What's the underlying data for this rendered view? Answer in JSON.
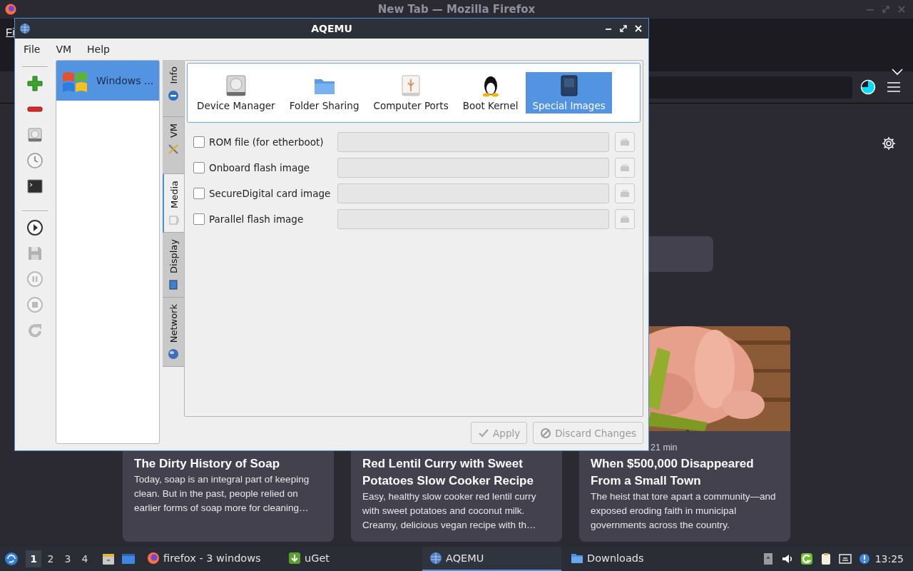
{
  "firefox": {
    "title": "New Tab — Mozilla Firefox",
    "menu": [
      "Fi"
    ],
    "cards": [
      {
        "title": "The Dirty History of Soap",
        "description": "Today, soap is an integral part of keeping clean. But in the past, people relied on earlier forms of soap more for cleaning…"
      },
      {
        "title": "Red Lentil Curry with Sweet Potatoes Slow Cooker Recipe",
        "description": "Easy, healthy slow cooker red lentil curry with sweet potatoes and coconut milk. Creamy, delicious vegan recipe with th…"
      },
      {
        "meta": "21 min",
        "title": "When $500,000 Disappeared From a Small Town",
        "description": "The heist that tore apart a community—and exposed eroding faith in municipal governments across the country."
      }
    ]
  },
  "aqemu": {
    "title": "AQEMU",
    "menu": [
      "File",
      "VM",
      "Help"
    ],
    "toolbar": [
      {
        "disabled": false
      },
      {
        "disabled": false
      },
      {
        "disabled": false
      },
      {
        "disabled": false
      },
      {
        "disabled": false
      },
      {
        "disabled": false
      },
      {
        "disabled": true
      },
      {
        "disabled": true
      },
      {
        "disabled": true
      },
      {
        "disabled": true
      }
    ],
    "vm_list": [
      {
        "name": "Windows ...",
        "selected": true
      }
    ],
    "side_tabs": [
      {
        "label": "Info",
        "selected": false
      },
      {
        "label": "VM",
        "selected": false
      },
      {
        "label": "Media",
        "selected": true
      },
      {
        "label": "Display",
        "selected": false
      },
      {
        "label": "Network",
        "selected": false
      }
    ],
    "sections": [
      {
        "label": "Device Manager",
        "selected": false
      },
      {
        "label": "Folder Sharing",
        "selected": false
      },
      {
        "label": "Computer Ports",
        "selected": false
      },
      {
        "label": "Boot Kernel",
        "selected": false
      },
      {
        "label": "Special Images",
        "selected": true
      }
    ],
    "images": [
      {
        "label": "ROM file (for etherboot)",
        "checked": false
      },
      {
        "label": "Onboard flash image",
        "checked": false
      },
      {
        "label": "SecureDigital card image",
        "checked": false
      },
      {
        "label": "Parallel flash image",
        "checked": false
      }
    ],
    "buttons": [
      {
        "label": "Apply",
        "disabled": true
      },
      {
        "label": "Discard Changes",
        "disabled": true
      }
    ]
  },
  "taskbar": {
    "workspaces": [
      {
        "label": "1",
        "selected": true
      },
      {
        "label": "2",
        "selected": false
      },
      {
        "label": "3",
        "selected": false
      },
      {
        "label": "4",
        "selected": false
      }
    ],
    "tasks": [
      {
        "label": "firefox - 3 windows",
        "selected": false
      },
      {
        "label": "uGet",
        "selected": false
      },
      {
        "label": "AQEMU",
        "selected": true
      },
      {
        "label": "Downloads",
        "selected": false
      }
    ],
    "clock": "13:25"
  }
}
